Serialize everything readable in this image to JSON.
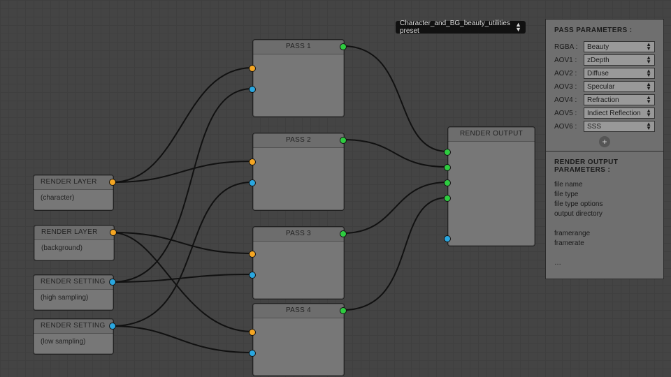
{
  "preset": {
    "label": "Character_and_BG_beauty_utilities preset"
  },
  "nodes": {
    "layer1": {
      "title": "RENDER LAYER",
      "sub": "(character)"
    },
    "layer2": {
      "title": "RENDER LAYER",
      "sub": "(background)"
    },
    "set1": {
      "title": "RENDER SETTING",
      "sub": "(high sampling)"
    },
    "set2": {
      "title": "RENDER SETTING",
      "sub": "(low sampling)"
    },
    "pass1": {
      "title": "PASS 1"
    },
    "pass2": {
      "title": "PASS 2"
    },
    "pass3": {
      "title": "PASS 3"
    },
    "pass4": {
      "title": "PASS 4"
    },
    "output": {
      "title": "RENDER OUTPUT"
    }
  },
  "passPanel": {
    "heading": "PASS PARAMETERS :",
    "rows": [
      {
        "k": "RGBA :",
        "v": "Beauty"
      },
      {
        "k": "AOV1 :",
        "v": "zDepth"
      },
      {
        "k": "AOV2 :",
        "v": "Diffuse"
      },
      {
        "k": "AOV3 :",
        "v": "Specular"
      },
      {
        "k": "AOV4 :",
        "v": "Refraction"
      },
      {
        "k": "AOV5 :",
        "v": "Indiect Reflection"
      },
      {
        "k": "AOV6 :",
        "v": "SSS"
      }
    ]
  },
  "outPanel": {
    "heading": "RENDER OUTPUT PARAMETERS :",
    "items": [
      "file name",
      "file type",
      "file type options",
      "output directory",
      "",
      "framerange",
      "framerate",
      "",
      "…"
    ]
  }
}
